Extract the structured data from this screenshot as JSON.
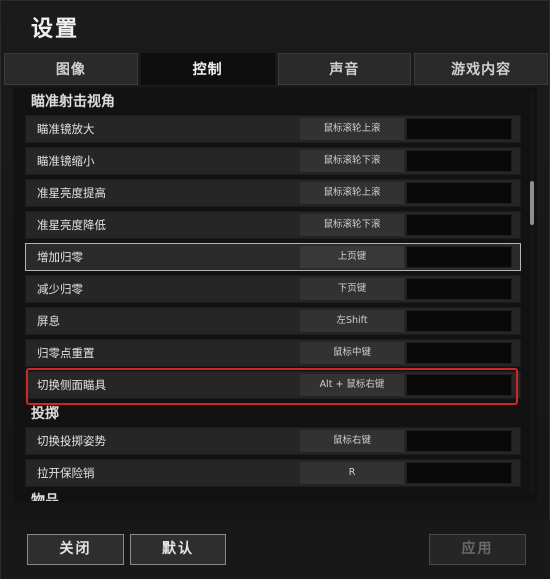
{
  "window": {
    "title": "设置"
  },
  "tabs": [
    {
      "label": "图像",
      "active": false
    },
    {
      "label": "控制",
      "active": true
    },
    {
      "label": "声音",
      "active": false
    },
    {
      "label": "游戏内容",
      "active": false
    }
  ],
  "sections": {
    "aim": {
      "title": "瞄准射击视角",
      "rows": [
        {
          "label": "瞄准镜放大",
          "key": "鼠标滚轮上滚",
          "key2": ""
        },
        {
          "label": "瞄准镜缩小",
          "key": "鼠标滚轮下滚",
          "key2": ""
        },
        {
          "label": "准星亮度提高",
          "key": "鼠标滚轮上滚",
          "key2": ""
        },
        {
          "label": "准星亮度降低",
          "key": "鼠标滚轮下滚",
          "key2": ""
        },
        {
          "label": "增加归零",
          "key": "上页键",
          "key2": ""
        },
        {
          "label": "减少归零",
          "key": "下页键",
          "key2": ""
        },
        {
          "label": "屏息",
          "key": "左Shift",
          "key2": ""
        },
        {
          "label": "归零点重置",
          "key": "鼠标中键",
          "key2": ""
        },
        {
          "label": "切换侧面瞄具",
          "key": "Alt + 鼠标右键",
          "key2": ""
        }
      ]
    },
    "throw": {
      "title": "投掷",
      "rows": [
        {
          "label": "切换投掷姿势",
          "key": "鼠标右键",
          "key2": ""
        },
        {
          "label": "拉开保险销",
          "key": "R",
          "key2": ""
        }
      ]
    },
    "items": {
      "title": "物品"
    }
  },
  "footer": {
    "close_label": "关闭",
    "default_label": "默认",
    "apply_label": "应用",
    "apply_enabled": false
  },
  "colors": {
    "highlight": "#d0262a",
    "active_tab": "#0e0e0e",
    "inactive_tab": "#2a2a2a"
  }
}
